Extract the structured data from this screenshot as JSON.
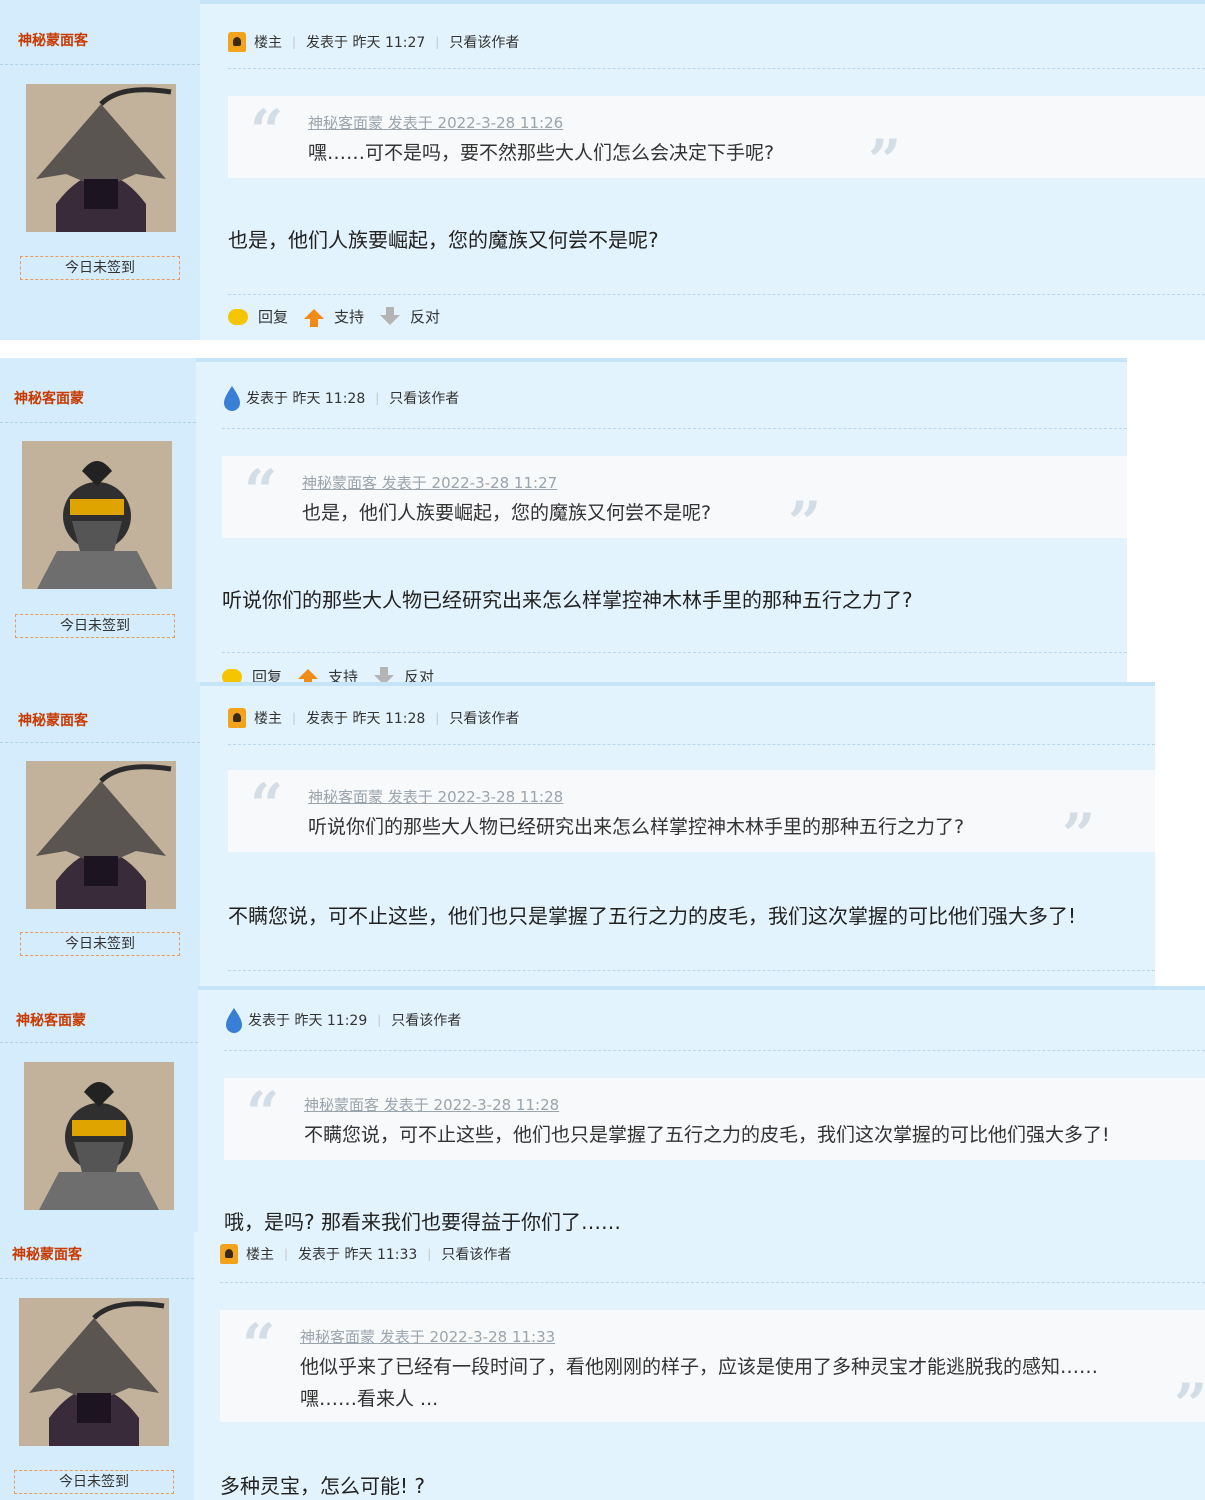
{
  "colors": {
    "author": "#c83a00",
    "sidebar": "#d4ecfb",
    "main": "#e3f3fd",
    "quote_bg": "#f8f9fa"
  },
  "posts": [
    {
      "author": "神秘蒙面客",
      "is_owner": true,
      "owner_label": "楼主",
      "posted": "发表于 昨天 11:27",
      "view_author": "只看该作者",
      "quote_head": "神秘客面蒙 发表于 2022-3-28 11:26",
      "quote_body": "嘿……可不是吗，要不然那些大人们怎么会决定下手呢?",
      "quote_body2": "",
      "content": "也是，他们人族要崛起，您的魔族又何尝不是呢?",
      "checkin": "今日未签到",
      "actions": {
        "reply": "回复",
        "support": "支持",
        "oppose": "反对"
      },
      "avatar": "hooded-avatar"
    },
    {
      "author": "神秘客面蒙",
      "is_owner": false,
      "owner_label": "",
      "posted": "发表于 昨天 11:28",
      "view_author": "只看该作者",
      "quote_head": "神秘蒙面客 发表于 2022-3-28 11:27",
      "quote_body": "也是，他们人族要崛起，您的魔族又何尝不是呢?",
      "quote_body2": "",
      "content": "听说你们的那些大人物已经研究出来怎么样掌控神木林手里的那种五行之力了?",
      "checkin": "今日未签到",
      "actions": {
        "reply": "回复",
        "support": "支持",
        "oppose": "反对"
      },
      "avatar": "masked-avatar"
    },
    {
      "author": "神秘蒙面客",
      "is_owner": true,
      "owner_label": "楼主",
      "posted": "发表于 昨天 11:28",
      "view_author": "只看该作者",
      "quote_head": "神秘客面蒙 发表于 2022-3-28 11:28",
      "quote_body": "听说你们的那些大人物已经研究出来怎么样掌控神木林手里的那种五行之力了?",
      "quote_body2": "",
      "content": "不瞒您说，可不止这些，他们也只是掌握了五行之力的皮毛，我们这次掌握的可比他们强大多了!",
      "checkin": "今日未签到",
      "actions": {
        "reply": "",
        "support": "",
        "oppose": ""
      },
      "avatar": "hooded-avatar"
    },
    {
      "author": "神秘客面蒙",
      "is_owner": false,
      "owner_label": "",
      "posted": "发表于 昨天 11:29",
      "view_author": "只看该作者",
      "quote_head": "神秘蒙面客 发表于 2022-3-28 11:28",
      "quote_body": "不瞒您说，可不止这些，他们也只是掌握了五行之力的皮毛，我们这次掌握的可比他们强大多了!",
      "quote_body2": "",
      "content": "哦，是吗? 那看来我们也要得益于你们了……",
      "checkin": "",
      "actions": {
        "reply": "",
        "support": "",
        "oppose": ""
      },
      "avatar": "masked-avatar"
    },
    {
      "author": "神秘蒙面客",
      "is_owner": true,
      "owner_label": "楼主",
      "posted": "发表于 昨天 11:33",
      "view_author": "只看该作者",
      "quote_head": "神秘客面蒙 发表于 2022-3-28 11:33",
      "quote_body": "他似乎来了已经有一段时间了，看他刚刚的样子，应该是使用了多种灵宝才能逃脱我的感知……",
      "quote_body2": "嘿……看来人 ...",
      "content": "多种灵宝，怎么可能! ?",
      "checkin": "今日未签到",
      "actions": {
        "reply": "",
        "support": "",
        "oppose": ""
      },
      "avatar": "hooded-avatar"
    }
  ]
}
